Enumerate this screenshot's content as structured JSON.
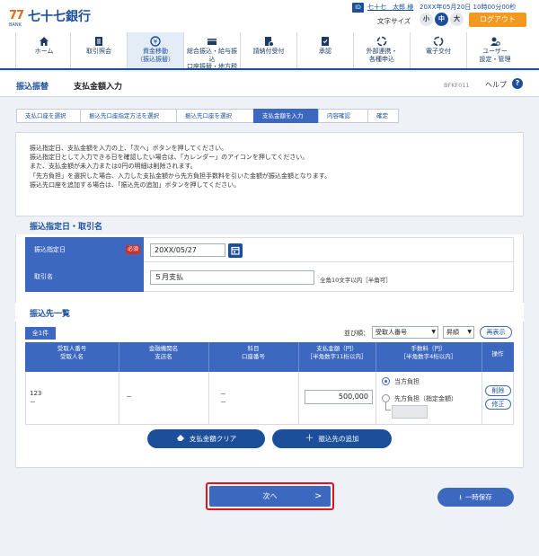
{
  "header": {
    "logo_mark": "77",
    "logo_sub": "BANK",
    "logo_text": "七十七銀行",
    "user_name": "七十七　太郎 様",
    "last_login": "20XX年05月20日 10時00分00秒",
    "font_size_label": "文字サイズ",
    "font_sizes": [
      "小",
      "中",
      "大"
    ],
    "logout": "ログアウト"
  },
  "menu": [
    {
      "line1": "ホーム",
      "line2": "",
      "icon": "home-icon"
    },
    {
      "line1": "取引照会",
      "line2": "",
      "icon": "document-list-icon"
    },
    {
      "line1": "資金移動",
      "line2": "（振込振替）",
      "icon": "money-transfer-icon",
      "active": true
    },
    {
      "line1": "総合振込・給与振込",
      "line2": "口座振替・地方税",
      "icon": "card-icon"
    },
    {
      "line1": "請納付受付",
      "line2": "",
      "icon": "payment-icon"
    },
    {
      "line1": "承認",
      "line2": "",
      "icon": "approval-icon"
    },
    {
      "line1": "外部連携・",
      "line2": "各種申込",
      "icon": "link-icon"
    },
    {
      "line1": "電子交付",
      "line2": "",
      "icon": "electronic-delivery-icon"
    },
    {
      "line1": "ユーザー",
      "line2": "設定・管理",
      "icon": "user-settings-icon"
    }
  ],
  "page": {
    "category": "振込振替",
    "title": "支払金額入力",
    "screen_id": "BFKF011",
    "help": "ヘルプ"
  },
  "steps": [
    "支払口座を選択",
    "振込先口座指定方法を選択",
    "振込先口座を選択",
    "支払金額を入力",
    "内容確認",
    "確定"
  ],
  "instructions": [
    "振込指定日、支払金額を入力の上、「次へ」ボタンを押してください。",
    "振込指定日として入力できる日を確認したい場合は、「カレンダー」のアイコンを押してください。",
    "また、支払金額が未入力または0円の明細は削除されます。",
    "「先方負担」を選択した場合、入力した支払金額から先方負担手数料を引いた金額が振込金額となります。",
    "振込先口座を追加する場合は、「振込先の追加」ボタンを押してください。"
  ],
  "section_date": {
    "title": "振込指定日・取引名",
    "date_label": "振込指定日",
    "required": "必須",
    "date_value": "20XX/05/27",
    "name_label": "取引名",
    "name_value": "５月支払",
    "name_note": "全角10文字以内［半角可］"
  },
  "section_list": {
    "title": "振込先一覧",
    "count": "全1件",
    "sort_label": "並び順：",
    "sort_key": "受取人番号",
    "sort_order": "昇順",
    "redisplay": "再表示",
    "headers": [
      {
        "l1": "受取人番号",
        "l2": "受取人名"
      },
      {
        "l1": "金融機関名",
        "l2": "支店名"
      },
      {
        "l1": "科目",
        "l2": "口座番号"
      },
      {
        "l1": "支払金額（円）",
        "l2": "［半角数字11桁以内］"
      },
      {
        "l1": "手数料（円）",
        "l2": "［半角数字4桁以内］"
      },
      {
        "l1": "操作",
        "l2": ""
      }
    ],
    "row": {
      "payee_no": "123",
      "payee_name": "－",
      "bank": "－",
      "type": "－",
      "account": "－",
      "amount": "500,000",
      "fee_option_1": "当方負担",
      "fee_option_2": "先方負担（指定金額）",
      "delete": "削除",
      "edit": "修正"
    }
  },
  "actions": {
    "clear": "支払金額クリア",
    "add": "振込先の追加",
    "next": "次へ",
    "save": "一時保存"
  }
}
